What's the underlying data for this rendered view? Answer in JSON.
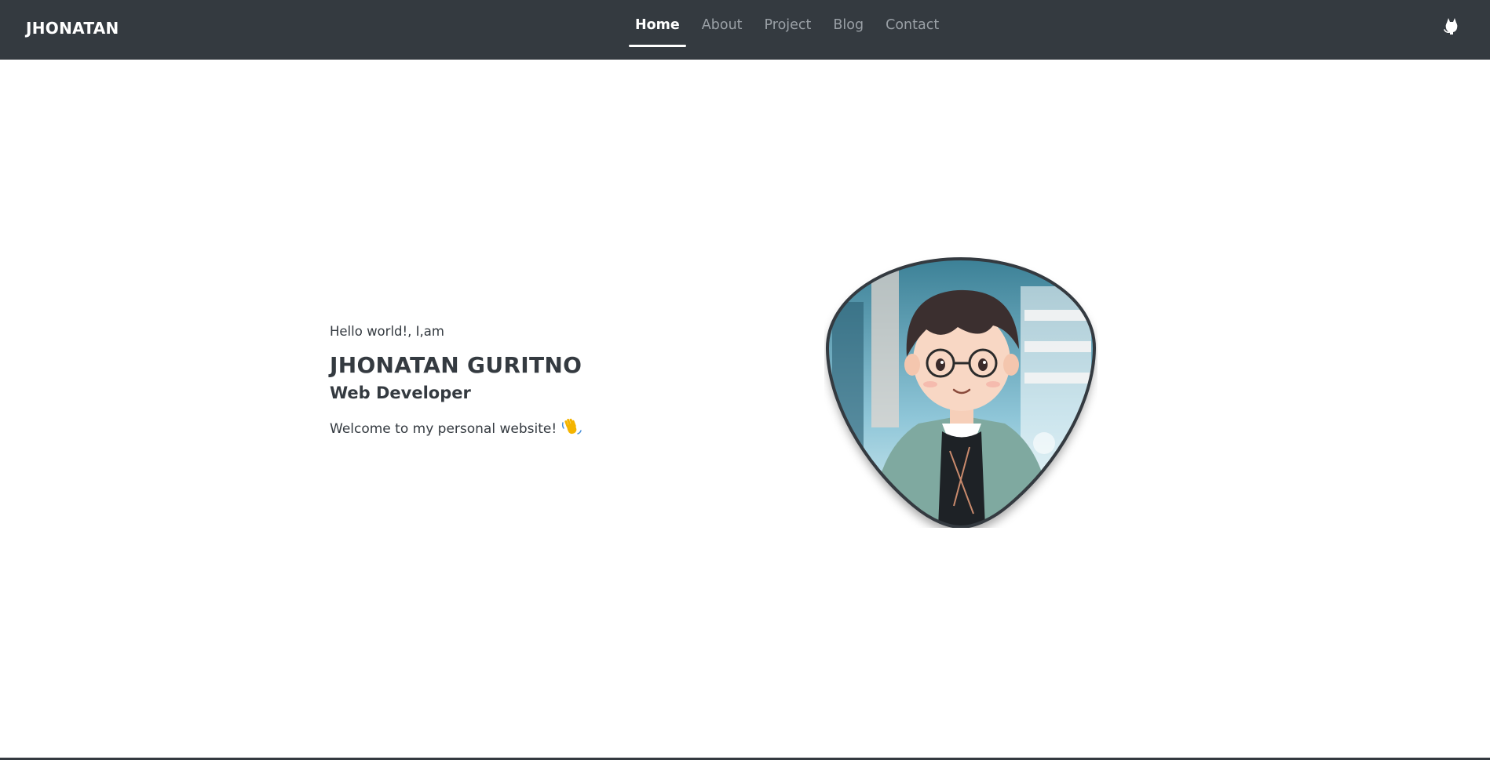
{
  "navbar": {
    "brand": "JHONATAN",
    "items": [
      {
        "label": "Home",
        "active": true
      },
      {
        "label": "About",
        "active": false
      },
      {
        "label": "Project",
        "active": false
      },
      {
        "label": "Blog",
        "active": false
      },
      {
        "label": "Contact",
        "active": false
      }
    ],
    "github_icon": "github-icon"
  },
  "hero": {
    "greeting": "Hello world!, I,am",
    "name": "JHONATAN GURITNO",
    "role": "Web Developer",
    "welcome": "Welcome to my personal website!",
    "wave_icon": "waving-hand-icon",
    "avatar_icon": "avatar-illustration"
  },
  "colors": {
    "navbar_bg": "#343a40",
    "text": "#343a40",
    "nav_inactive": "#9aa0a6",
    "nav_active": "#ffffff"
  }
}
